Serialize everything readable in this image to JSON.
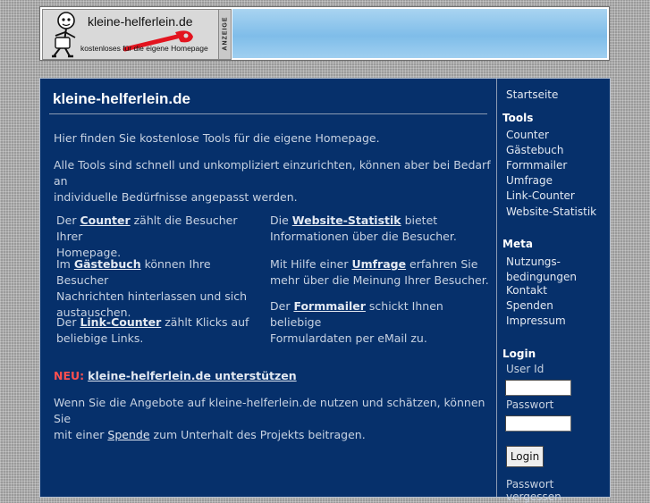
{
  "banner": {
    "logo_name": "kleine-helferlein.de",
    "logo_tagline": "kostenloses für die eigene Homepage",
    "ad_label": "ANZEIGE"
  },
  "content": {
    "title": "kleine-helferlein.de",
    "intro_1": "Hier finden Sie kostenlose Tools für die eigene Homepage.",
    "intro_2_line_1": "Alle Tools sind schnell und unkompliziert einzurichten, können aber bei Bedarf an",
    "intro_2_line_2": "individuelle Bedürfnisse angepasst werden.",
    "tools_left": [
      {
        "pre": "Der ",
        "kw": "Counter",
        "line_1": " zählt die Besucher Ihrer",
        "line_2": "Homepage."
      },
      {
        "pre": "Im ",
        "kw": "Gästebuch",
        "line_1": " können Ihre Besucher",
        "line_2": "Nachrichten hinterlassen und sich",
        "line_3": "austauschen."
      },
      {
        "pre": "Der ",
        "kw": "Link-Counter",
        "line_1": " zählt Klicks auf",
        "line_2": "beliebige Links."
      }
    ],
    "tools_right": [
      {
        "pre": "Die ",
        "kw": "Website-Statistik",
        "line_1": " bietet",
        "line_2": "Informationen über die Besucher."
      },
      {
        "pre": "Mit Hilfe einer ",
        "kw": "Umfrage",
        "line_1": " erfahren Sie",
        "line_2": "mehr über die Meinung Ihrer Besucher."
      },
      {
        "pre": "Der ",
        "kw": "Formmailer",
        "line_1": " schickt Ihnen beliebige",
        "line_2": "Formulardaten per eMail zu."
      }
    ],
    "news_label": "NEU:",
    "news_link": "kleine-helferlein.de unterstützen",
    "support_line_1": "Wenn Sie die Angebote auf kleine-helferlein.de nutzen und schätzen, können Sie",
    "support_pre": "mit einer ",
    "support_link": "Spende",
    "support_post": " zum Unterhalt des Projekts beitragen."
  },
  "sidebar": {
    "home": "Startseite",
    "tools_heading": "Tools",
    "tools": [
      "Counter",
      "Gästebuch",
      "Formmailer",
      "Umfrage",
      "Link-Counter",
      "Website-Statistik"
    ],
    "meta_heading": "Meta",
    "meta_terms_line_1": "Nutzungs-",
    "meta_terms_line_2": "bedingungen",
    "meta": [
      "Kontakt",
      "Spenden",
      "Impressum"
    ],
    "login_heading": "Login",
    "userid_label": "User Id",
    "userid_value": "",
    "password_label": "Passwort",
    "password_value": "",
    "login_button": "Login",
    "forgot_password": "Passwort vergessen"
  },
  "colors": {
    "panel_bg": "#06306b",
    "news_red": "#ff4f4f",
    "banner_blue": "#7fbde9"
  }
}
